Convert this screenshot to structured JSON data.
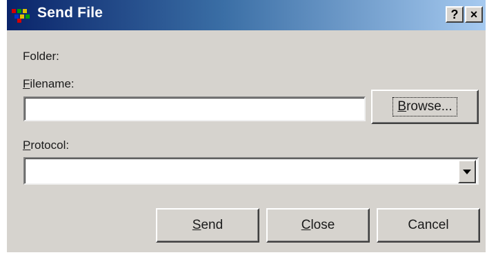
{
  "window": {
    "title": "Send File",
    "help_button": "?",
    "close_button": "×"
  },
  "folder": {
    "label": "Folder:"
  },
  "filename": {
    "label_first": "F",
    "label_rest": "ilename:",
    "value": "",
    "browse_first": "B",
    "browse_rest": "rowse..."
  },
  "protocol": {
    "label_first": "P",
    "label_rest": "rotocol:",
    "selected": ""
  },
  "actions": {
    "send_first": "S",
    "send_rest": "end",
    "close_first": "C",
    "close_rest": "lose",
    "cancel_label": "Cancel"
  },
  "colors": {
    "dialog_face": "#d6d3ce",
    "titlebar_start": "#0a246a",
    "titlebar_end": "#a6caf0"
  }
}
